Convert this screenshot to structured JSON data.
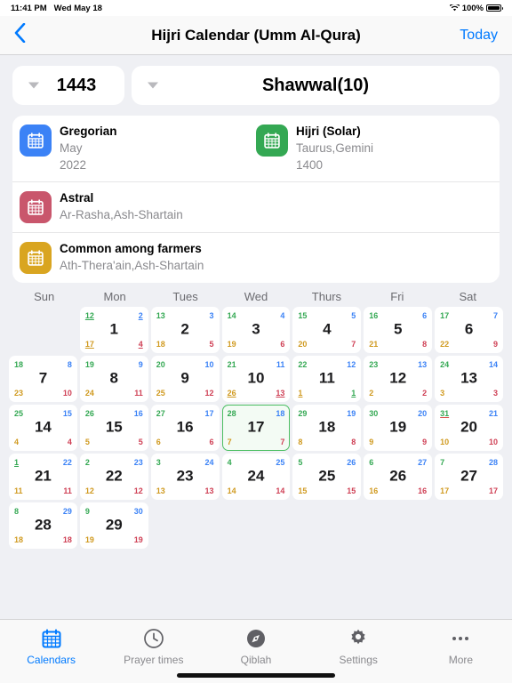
{
  "statusbar": {
    "time": "11:41 PM",
    "date": "Wed May 18",
    "battery": "100%",
    "wifi_icon": "wifi-icon",
    "battery_icon": "battery-icon"
  },
  "navbar": {
    "back_icon": "chevron-left-icon",
    "title": "Hijri Calendar (Umm Al-Qura)",
    "today_label": "Today"
  },
  "selectors": {
    "year": {
      "value": "1443",
      "caret_icon": "chevron-down-icon"
    },
    "month": {
      "value": "Shawwal(10)",
      "caret_icon": "chevron-down-icon"
    }
  },
  "info": {
    "rows": [
      {
        "items": [
          {
            "icon": "calendar-icon",
            "color": "#3b82f6",
            "title": "Gregorian",
            "line1": "May",
            "line2": "2022"
          },
          {
            "icon": "calendar-icon",
            "color": "#34a853",
            "title": "Hijri (Solar)",
            "line1": "Taurus,Gemini",
            "line2": "1400"
          }
        ]
      },
      {
        "items": [
          {
            "icon": "calendar-icon",
            "color": "#c9566c",
            "title": "Astral",
            "line1": "Ar-Rasha,Ash-Shartain",
            "line2": ""
          }
        ]
      },
      {
        "items": [
          {
            "icon": "calendar-icon",
            "color": "#d9a520",
            "title": "Common among farmers",
            "line1": "Ath-Thera'ain,Ash-Shartain",
            "line2": ""
          }
        ]
      }
    ]
  },
  "calendar": {
    "weekdays": [
      "Sun",
      "Mon",
      "Tues",
      "Wed",
      "Thurs",
      "Fri",
      "Sat"
    ],
    "cells": [
      {
        "empty": true
      },
      {
        "main": "1",
        "tl": "12",
        "tr": "2",
        "bl": "17",
        "br": "4",
        "tl_u": true,
        "tr_u": true,
        "bl_u": true,
        "br_u": true
      },
      {
        "main": "2",
        "tl": "13",
        "tr": "3",
        "bl": "18",
        "br": "5"
      },
      {
        "main": "3",
        "tl": "14",
        "tr": "4",
        "bl": "19",
        "br": "6"
      },
      {
        "main": "4",
        "tl": "15",
        "tr": "5",
        "bl": "20",
        "br": "7"
      },
      {
        "main": "5",
        "tl": "16",
        "tr": "6",
        "bl": "21",
        "br": "8"
      },
      {
        "main": "6",
        "tl": "17",
        "tr": "7",
        "bl": "22",
        "br": "9"
      },
      {
        "main": "7",
        "tl": "18",
        "tr": "8",
        "bl": "23",
        "br": "10"
      },
      {
        "main": "8",
        "tl": "19",
        "tr": "9",
        "bl": "24",
        "br": "11"
      },
      {
        "main": "9",
        "tl": "20",
        "tr": "10",
        "bl": "25",
        "br": "12"
      },
      {
        "main": "10",
        "tl": "21",
        "tr": "11",
        "bl": "26",
        "br": "13",
        "bl_u": true,
        "br_u": true
      },
      {
        "main": "11",
        "tl": "22",
        "tr": "12",
        "bl": "1",
        "br": "1",
        "bl_u": true,
        "br_u": true,
        "br_green": true
      },
      {
        "main": "12",
        "tl": "23",
        "tr": "13",
        "bl": "2",
        "br": "2"
      },
      {
        "main": "13",
        "tl": "24",
        "tr": "14",
        "bl": "3",
        "br": "3"
      },
      {
        "main": "14",
        "tl": "25",
        "tr": "15",
        "bl": "4",
        "br": "4"
      },
      {
        "main": "15",
        "tl": "26",
        "tr": "16",
        "bl": "5",
        "br": "5"
      },
      {
        "main": "16",
        "tl": "27",
        "tr": "17",
        "bl": "6",
        "br": "6"
      },
      {
        "main": "17",
        "tl": "28",
        "tr": "18",
        "bl": "7",
        "br": "7",
        "today": true
      },
      {
        "main": "18",
        "tl": "29",
        "tr": "19",
        "bl": "8",
        "br": "8"
      },
      {
        "main": "19",
        "tl": "30",
        "tr": "20",
        "bl": "9",
        "br": "9"
      },
      {
        "main": "20",
        "tl": "31",
        "tr": "21",
        "bl": "10",
        "br": "10",
        "tl_u": true,
        "tl_u_red": true
      },
      {
        "main": "21",
        "tl": "1",
        "tr": "22",
        "bl": "11",
        "br": "11",
        "tl_u": true
      },
      {
        "main": "22",
        "tl": "2",
        "tr": "23",
        "bl": "12",
        "br": "12"
      },
      {
        "main": "23",
        "tl": "3",
        "tr": "24",
        "bl": "13",
        "br": "13"
      },
      {
        "main": "24",
        "tl": "4",
        "tr": "25",
        "bl": "14",
        "br": "14"
      },
      {
        "main": "25",
        "tl": "5",
        "tr": "26",
        "bl": "15",
        "br": "15"
      },
      {
        "main": "26",
        "tl": "6",
        "tr": "27",
        "bl": "16",
        "br": "16"
      },
      {
        "main": "27",
        "tl": "7",
        "tr": "28",
        "bl": "17",
        "br": "17"
      },
      {
        "main": "28",
        "tl": "8",
        "tr": "29",
        "bl": "18",
        "br": "18"
      },
      {
        "main": "29",
        "tl": "9",
        "tr": "30",
        "bl": "19",
        "br": "19"
      },
      {
        "empty": true
      },
      {
        "empty": true
      },
      {
        "empty": true
      },
      {
        "empty": true
      },
      {
        "empty": true
      }
    ]
  },
  "tabbar": {
    "tabs": [
      {
        "label": "Calendars",
        "icon": "calendar-icon",
        "active": true
      },
      {
        "label": "Prayer times",
        "icon": "clock-icon",
        "active": false
      },
      {
        "label": "Qiblah",
        "icon": "compass-icon",
        "active": false
      },
      {
        "label": "Settings",
        "icon": "gear-icon",
        "active": false
      },
      {
        "label": "More",
        "icon": "ellipsis-icon",
        "active": false
      }
    ]
  },
  "colors": {
    "accent": "#007aff",
    "today_green": "#4cbf63",
    "corner_tl": "#34a853",
    "corner_tr": "#3b82f6",
    "corner_bl": "#d09a20",
    "corner_br": "#cf4055"
  }
}
